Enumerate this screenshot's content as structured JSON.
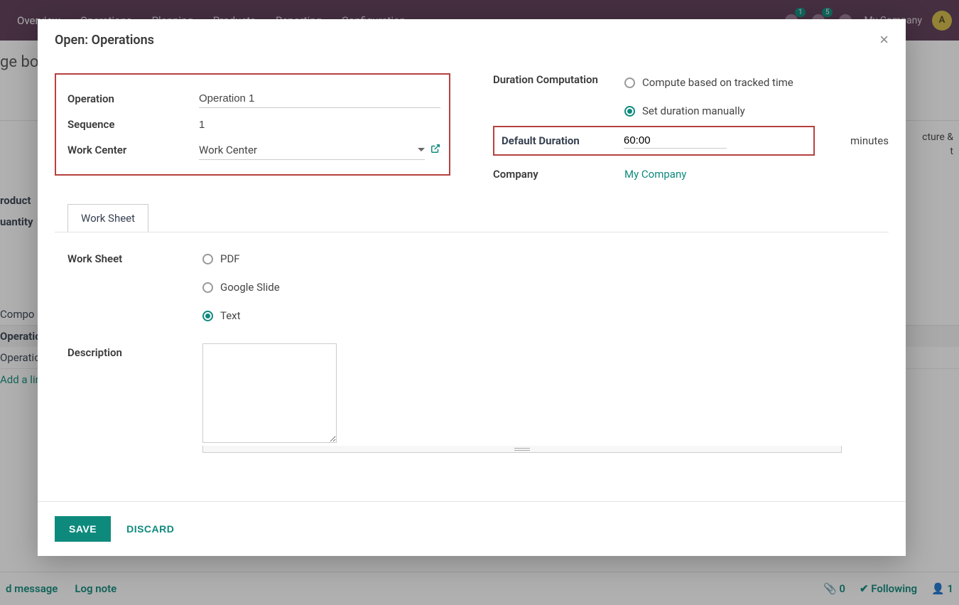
{
  "topbar": {
    "nav": [
      "Overview",
      "Operations",
      "Planning",
      "Products",
      "Reporting",
      "Configuration"
    ],
    "badge1": "1",
    "badge2": "5",
    "company": "My Company",
    "avatar_letter": "A"
  },
  "bg": {
    "title": "ge bo",
    "product": "roduct",
    "quantity": "uantity",
    "compo": "Compo",
    "ops_header": "Operatio",
    "op_row": "Operatio",
    "add_line": "Add a lin",
    "right_line1": "cture &",
    "right_line2": "t",
    "footer": {
      "send": "d message",
      "log": "Log note",
      "attach": "0",
      "following": "Following",
      "followers": "1"
    }
  },
  "modal": {
    "title": "Open: Operations",
    "left": {
      "operation_label": "Operation",
      "operation_value": "Operation 1",
      "sequence_label": "Sequence",
      "sequence_value": "1",
      "workcenter_label": "Work Center",
      "workcenter_value": "Work Center"
    },
    "right": {
      "duration_comp_label": "Duration Computation",
      "opt_tracked": "Compute based on tracked time",
      "opt_manual": "Set duration manually",
      "default_duration_label": "Default Duration",
      "default_duration_value": "60:00",
      "minutes": "minutes",
      "company_label": "Company",
      "company_value": "My Company"
    },
    "tab": "Work Sheet",
    "worksheet": {
      "label": "Work Sheet",
      "opt_pdf": "PDF",
      "opt_gslide": "Google Slide",
      "opt_text": "Text",
      "desc_label": "Description"
    },
    "footer": {
      "save": "SAVE",
      "discard": "DISCARD"
    }
  }
}
